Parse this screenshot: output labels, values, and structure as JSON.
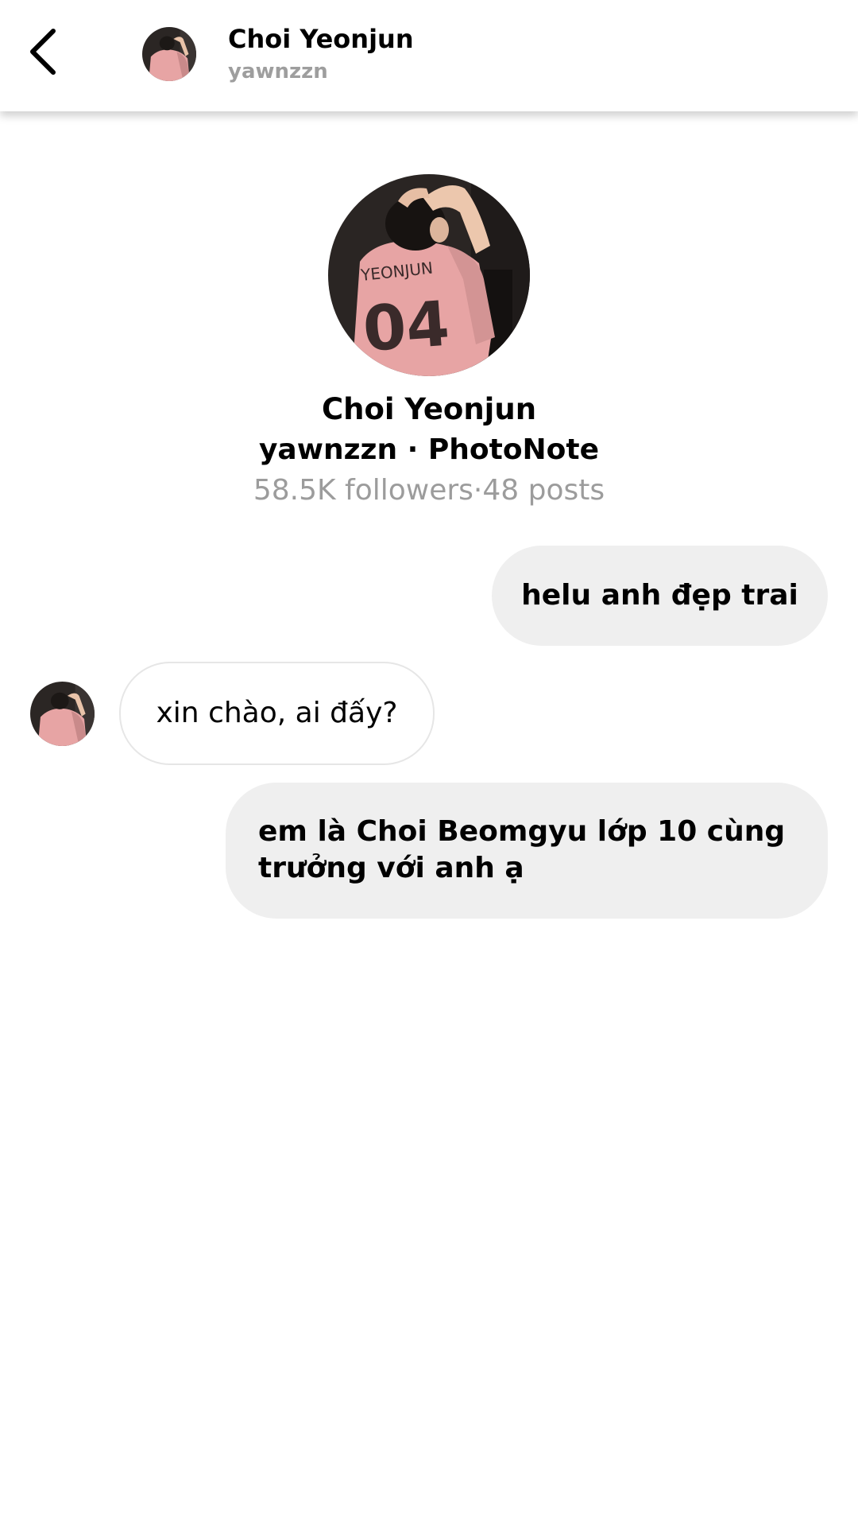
{
  "header": {
    "back_icon": "chevron-left-icon",
    "name": "Choi Yeonjun",
    "username": "yawnzzn"
  },
  "profile": {
    "name": "Choi Yeonjun",
    "subtitle": "yawnzzn · PhotoNote",
    "stats": "58.5K followers·48 posts",
    "jersey_text": "YEONJUN",
    "jersey_number": "04"
  },
  "messages": [
    {
      "sender": "me",
      "text": "helu anh đẹp trai"
    },
    {
      "sender": "other",
      "text": "xin chào, ai đấy?"
    },
    {
      "sender": "me",
      "text": "em là Choi Beomgyu lớp 10 cùng trưởng với anh ạ"
    }
  ],
  "colors": {
    "sent_bubble": "#efefef",
    "received_border": "#e6e6e6",
    "secondary_text": "#9c9c9c",
    "jersey_pink": "#e7a4a4"
  }
}
